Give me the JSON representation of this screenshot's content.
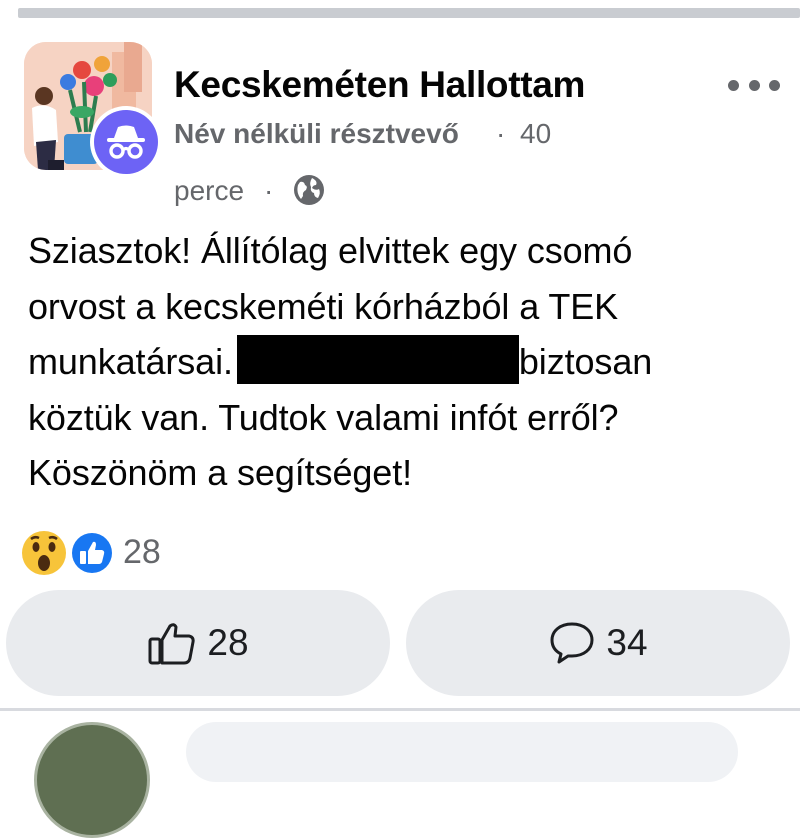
{
  "post": {
    "group_name": "Kecskeméten Hallottam",
    "author": "Név nélküli résztvevő",
    "separator": "·",
    "time_part1": "40",
    "time_part2": "perce",
    "text_lines": [
      "Sziasztok! Állítólag elvittek egy csomó",
      "orvost a kecskeméti kórházból a TEK",
      "munkatársai.",
      "biztosan",
      "köztük van. Tudtok valami infót erről?",
      "Köszönöm a segítséget!"
    ],
    "reaction_icons": [
      "wow-icon",
      "like-icon"
    ],
    "reaction_count": "28",
    "like_count": "28",
    "comment_count": "34"
  },
  "colors": {
    "secondary_text": "#65676b",
    "pill_bg": "#e9ebee",
    "like_blue": "#1877f2",
    "anon_purple": "#6d63f5"
  }
}
